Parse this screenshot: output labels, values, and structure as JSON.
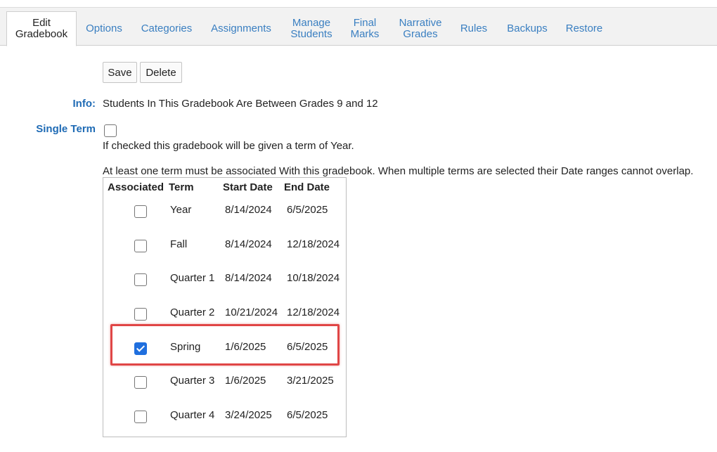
{
  "tabs": [
    {
      "id": "edit-gradebook",
      "lines": [
        "Edit",
        "Gradebook"
      ],
      "active": true
    },
    {
      "id": "options",
      "lines": [
        "Options"
      ]
    },
    {
      "id": "categories",
      "lines": [
        "Categories"
      ]
    },
    {
      "id": "assignments",
      "lines": [
        "Assignments"
      ]
    },
    {
      "id": "manage-students",
      "lines": [
        "Manage",
        "Students"
      ]
    },
    {
      "id": "final-marks",
      "lines": [
        "Final",
        "Marks"
      ]
    },
    {
      "id": "narrative-grades",
      "lines": [
        "Narrative",
        "Grades"
      ]
    },
    {
      "id": "rules",
      "lines": [
        "Rules"
      ]
    },
    {
      "id": "backups",
      "lines": [
        "Backups"
      ]
    },
    {
      "id": "restore",
      "lines": [
        "Restore"
      ]
    }
  ],
  "toolbar": {
    "save_label": "Save",
    "delete_label": "Delete"
  },
  "info": {
    "label": "Info:",
    "text": "Students In This Gradebook Are Between Grades 9 and 12"
  },
  "single_term": {
    "label": "Single Term",
    "checked": false,
    "help": "If checked this gradebook will be given a term of Year."
  },
  "terms_note": "At least one term must be associated With this gradebook. When multiple terms are selected their Date ranges cannot overlap.",
  "terms_table": {
    "headers": {
      "associated": "Associated",
      "term": "Term",
      "start": "Start Date",
      "end": "End Date"
    },
    "rows": [
      {
        "term": "Year",
        "start": "8/14/2024",
        "end": "6/5/2025",
        "associated": false
      },
      {
        "term": "Fall",
        "start": "8/14/2024",
        "end": "12/18/2024",
        "associated": false
      },
      {
        "term": "Quarter 1",
        "start": "8/14/2024",
        "end": "10/18/2024",
        "associated": false
      },
      {
        "term": "Quarter 2",
        "start": "10/21/2024",
        "end": "12/18/2024",
        "associated": false
      },
      {
        "term": "Spring",
        "start": "1/6/2025",
        "end": "6/5/2025",
        "associated": true
      },
      {
        "term": "Quarter 3",
        "start": "1/6/2025",
        "end": "3/21/2025",
        "associated": false
      },
      {
        "term": "Quarter 4",
        "start": "3/24/2025",
        "end": "6/5/2025",
        "associated": false
      }
    ]
  },
  "colors": {
    "link": "#3a7fc1",
    "label": "#1f6bb5",
    "checkbox_checked": "#1f6fde",
    "highlight": "#e04646"
  }
}
